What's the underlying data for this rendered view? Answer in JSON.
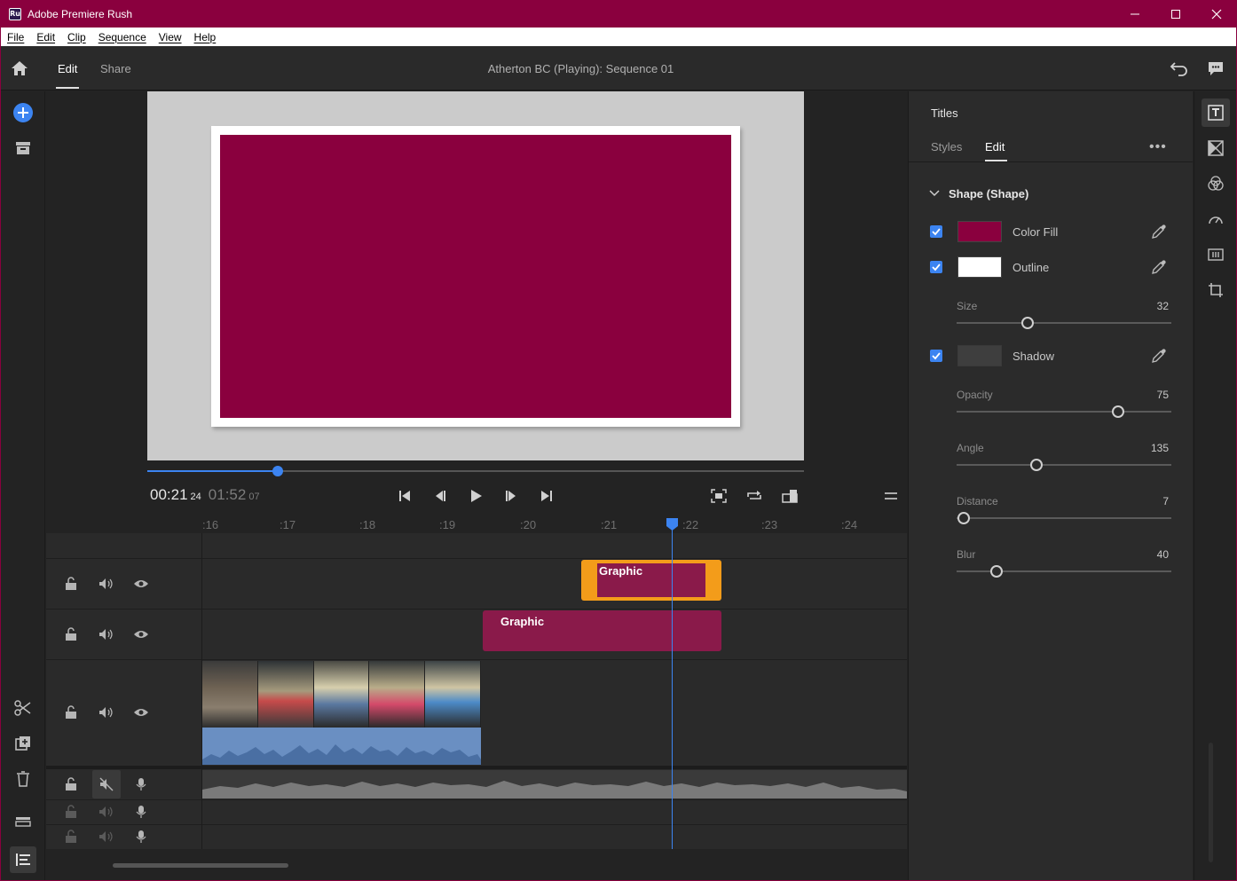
{
  "window": {
    "title": "Adobe Premiere Rush",
    "app_icon": "Ru",
    "controls": [
      "minimize",
      "maximize",
      "close"
    ]
  },
  "menu": [
    "File",
    "Edit",
    "Clip",
    "Sequence",
    "View",
    "Help"
  ],
  "header": {
    "tabs": [
      {
        "label": "Edit",
        "active": true
      },
      {
        "label": "Share",
        "active": false
      }
    ],
    "project_title": "Atherton BC (Playing): Sequence 01"
  },
  "player": {
    "current_time": "00:21",
    "current_frames": "24",
    "duration": "01:52",
    "duration_frames": "07",
    "scrub_progress": 0.2
  },
  "timeline": {
    "ruler": [
      ":16",
      ":17",
      ":18",
      ":19",
      ":20",
      ":21",
      ":22",
      ":23",
      ":24"
    ],
    "clips": {
      "selected_label": "Graphic",
      "second_label": "Graphic"
    }
  },
  "titles_panel": {
    "title": "Titles",
    "tabs": [
      {
        "label": "Styles",
        "active": false
      },
      {
        "label": "Edit",
        "active": true
      }
    ],
    "more": "•••",
    "section": "Shape (Shape)",
    "color_fill": {
      "label": "Color Fill",
      "checked": true,
      "color": "#8a003e"
    },
    "outline": {
      "label": "Outline",
      "checked": true,
      "color": "#ffffff"
    },
    "size": {
      "label": "Size",
      "value": "32",
      "fraction": 0.33
    },
    "shadow": {
      "label": "Shadow",
      "checked": true
    },
    "opacity": {
      "label": "Opacity",
      "value": "75",
      "fraction": 0.75
    },
    "angle": {
      "label": "Angle",
      "value": "135",
      "fraction": 0.37
    },
    "distance": {
      "label": "Distance",
      "value": "7",
      "fraction": 0.035
    },
    "blur": {
      "label": "Blur",
      "value": "40",
      "fraction": 0.185
    }
  },
  "colors": {
    "brand": "#8a003e",
    "accent": "#3c84f1",
    "selection": "#f39c1a",
    "clip": "#8a1a4a"
  }
}
